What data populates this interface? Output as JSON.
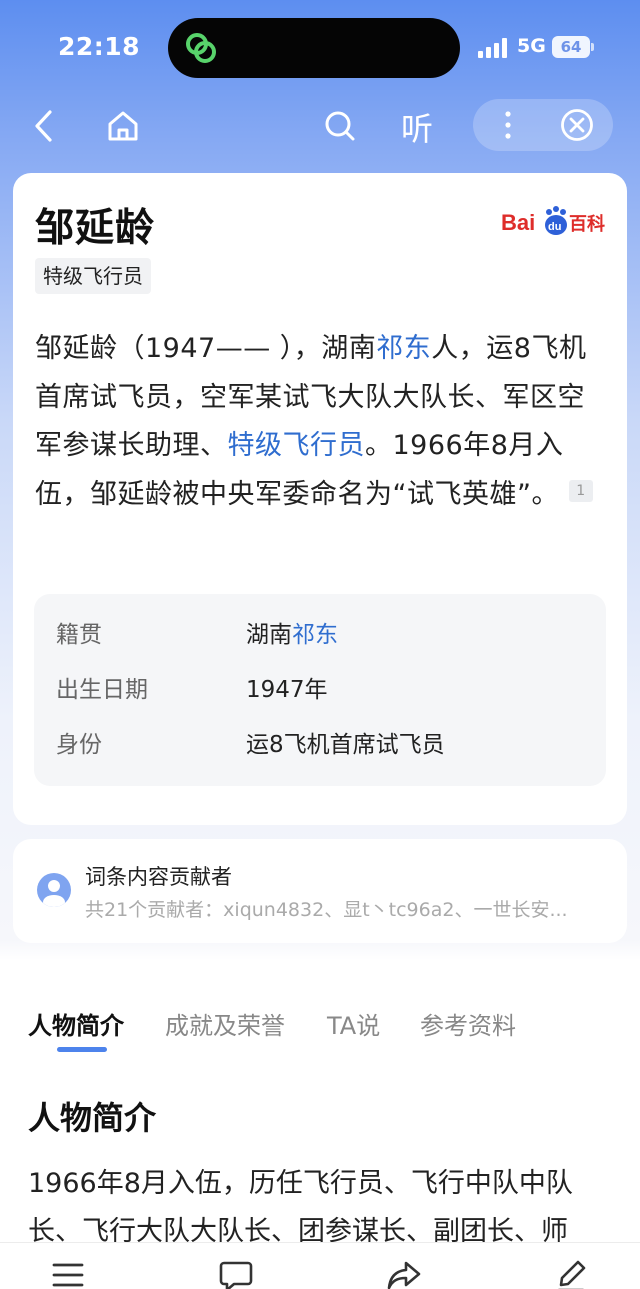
{
  "status_bar": {
    "time": "22:18",
    "network": "5G",
    "battery": "64"
  },
  "nav": {
    "listen_label": "听"
  },
  "article": {
    "title": "邹延龄",
    "tag": "特级飞行员",
    "logo_text": "Bai百科",
    "description_parts": [
      {
        "text": "邹延龄（1947—— ），湖南",
        "link": false
      },
      {
        "text": "祁东",
        "link": true
      },
      {
        "text": "人，运8飞机首席试飞员，空军某试飞大队大队长、军区空军参谋长助理、",
        "link": false
      },
      {
        "text": "特级飞行员",
        "link": true
      },
      {
        "text": "。1966年8月入伍，邹延龄被中央军委命名为“试飞英雄”。",
        "link": false
      }
    ],
    "reference_mark": "1",
    "info": [
      {
        "key": "籍贯",
        "value_prefix": "湖南",
        "value_link": "祁东"
      },
      {
        "key": "出生日期",
        "value_prefix": "1947年",
        "value_link": ""
      },
      {
        "key": "身份",
        "value_prefix": "运8飞机首席试飞员",
        "value_link": ""
      }
    ]
  },
  "contributors": {
    "title": "词条内容贡献者",
    "subtitle": "共21个贡献者：xiqun4832、显t丶tc96a2、一世长安..."
  },
  "tabs": [
    {
      "label": "人物简介",
      "active": true
    },
    {
      "label": "成就及荣誉",
      "active": false
    },
    {
      "label": "TA说",
      "active": false
    },
    {
      "label": "参考资料",
      "active": false
    }
  ],
  "section": {
    "title": "人物简介",
    "lines": [
      "1966年8月入伍，历任飞行员、飞行中队中队",
      "长、飞行大队大队长、团参谋长、副团长、师"
    ]
  },
  "colors": {
    "accent": "#2f6dcf",
    "tab_indicator": "#4d83ec"
  }
}
